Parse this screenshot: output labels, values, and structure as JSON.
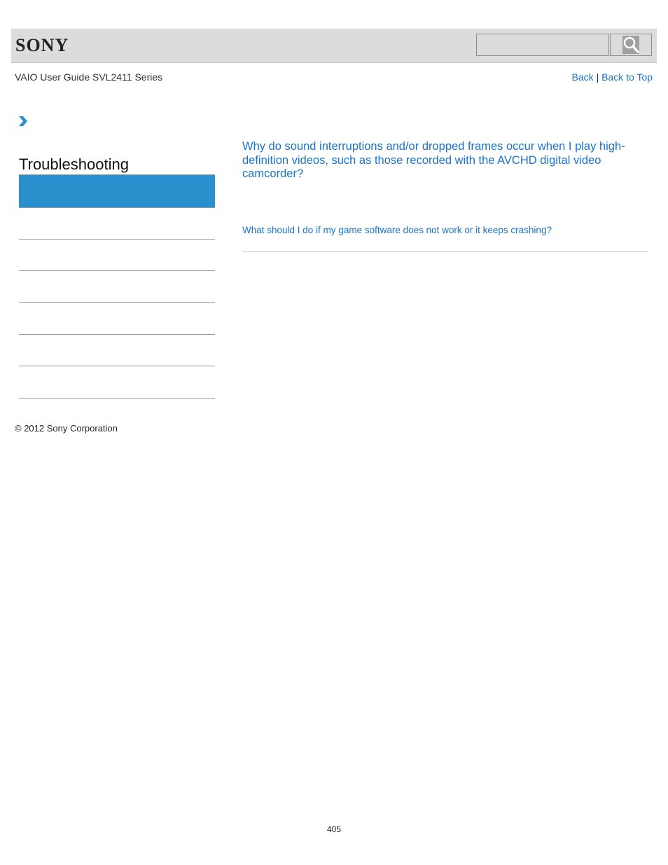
{
  "header": {
    "logo": "SONY",
    "search": {
      "placeholder": "",
      "value": ""
    },
    "search_icon": "search-icon"
  },
  "subheader": {
    "guide_title": "VAIO User Guide SVL2411 Series",
    "back_label": "Back",
    "separator": "|",
    "back_to_top_label": "Back to Top"
  },
  "sidebar": {
    "breadcrumb_icon": "chevron-right-icon",
    "section_title": "Troubleshooting",
    "items": [
      {
        "label": ""
      },
      {
        "label": ""
      },
      {
        "label": ""
      },
      {
        "label": ""
      },
      {
        "label": ""
      },
      {
        "label": ""
      },
      {
        "label": ""
      }
    ]
  },
  "main": {
    "links": [
      {
        "text": "Why do sound interruptions and/or dropped frames occur when I play high-definition videos, such as those recorded with the AVCHD digital video camcorder?"
      },
      {
        "text": "What should I do if my game software does not work or it keeps crashing?"
      }
    ]
  },
  "footer": {
    "copyright": "© 2012 Sony Corporation",
    "page_number": "405"
  },
  "colors": {
    "accent": "#2a8fcd",
    "link": "#1a73c8",
    "header_bg": "#dcdcdc"
  }
}
